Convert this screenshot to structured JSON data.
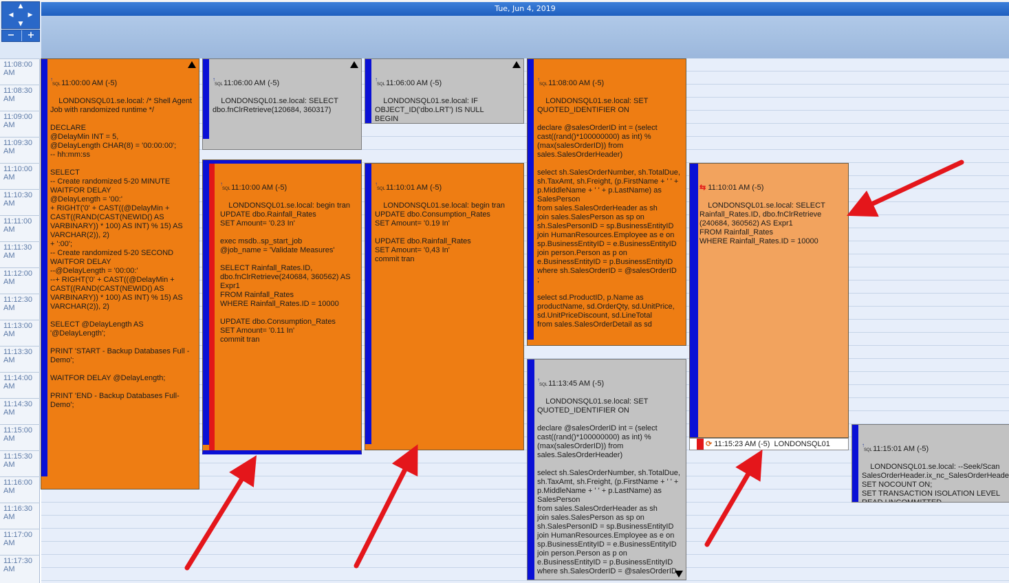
{
  "header": {
    "date": "Tue, Jun 4, 2019"
  },
  "nav": {
    "zoom_out": "−",
    "zoom_in": "+"
  },
  "times": [
    "11:08:00 AM",
    "11:08:30 AM",
    "11:09:00 AM",
    "11:09:30 AM",
    "11:10:00 AM",
    "11:10:30 AM",
    "11:11:00 AM",
    "11:11:30 AM",
    "11:12:00 AM",
    "11:12:30 AM",
    "11:13:00 AM",
    "11:13:30 AM",
    "11:14:00 AM",
    "11:14:30 AM",
    "11:15:00 AM",
    "11:15:30 AM",
    "11:16:00 AM",
    "11:16:30 AM",
    "11:17:00 AM",
    "11:17:30 AM"
  ],
  "icons": {
    "sql": "SQL",
    "bar_colors": {
      "blue": "#0a10d6",
      "red": "#e21818"
    }
  },
  "events": {
    "e1": {
      "time": "11:00:00 AM (-5)",
      "text": "LONDONSQL01.se.local: /* Shell Agent Job with randomized runtime */\n\nDECLARE\n@DelayMin INT = 5,\n@DelayLength CHAR(8) = '00:00:00';\n-- hh:mm:ss\n\nSELECT\n-- Create randomized 5-20 MINUTE WAITFOR DELAY\n@DelayLength = '00:'\n+ RIGHT('0' + CAST((@DelayMin + CAST((RAND(CAST(NEWID() AS VARBINARY)) * 100) AS INT) % 15) AS VARCHAR(2)), 2)\n+ ':00';\n-- Create randomized 5-20 SECOND WAITFOR DELAY\n--@DelayLength = '00:00:'\n--+ RIGHT('0' + CAST((@DelayMin + CAST((RAND(CAST(NEWID() AS VARBINARY)) * 100) AS INT) % 15) AS VARCHAR(2)), 2)\n\nSELECT @DelayLength AS '@DelayLength';\n\nPRINT 'START - Backup Databases Full -Demo';\n\nWAITFOR DELAY @DelayLength;\n\nPRINT 'END - Backup Databases Full-Demo';"
    },
    "e2": {
      "time": "11:06:00 AM (-5)",
      "text": "LONDONSQL01.se.local: SELECT dbo.fnClrRetrieve(120684, 360317)"
    },
    "e3": {
      "time": "11:06:00 AM (-5)",
      "text": "LONDONSQL01.se.local: IF OBJECT_ID('dbo.LRT') IS NULL\nBEGIN\nCREATE TABLE dbo.LRT\n(lrtid INT IDENTITY PRIMARY KEY CLUSTERED"
    },
    "e4": {
      "time": "11:08:00 AM (-5)",
      "text": "LONDONSQL01.se.local: SET QUOTED_IDENTIFIER ON\n\ndeclare @salesOrderID int = (select cast((rand()*100000000) as int) % (max(salesOrderID)) from sales.SalesOrderHeader)\n\nselect sh.SalesOrderNumber, sh.TotalDue, sh.TaxAmt, sh.Freight, (p.FirstName + ' ' + p.MiddleName + ' ' + p.LastName) as SalesPerson\nfrom sales.SalesOrderHeader as sh\njoin sales.SalesPerson as sp on sh.SalesPersonID = sp.BusinessEntityID\njoin HumanResources.Employee as e on sp.BusinessEntityID = e.BusinessEntityID\njoin person.Person as p on e.BusinessEntityID = p.BusinessEntityID\nwhere sh.SalesOrderID = @salesOrderID\n;\n\nselect sd.ProductID, p.Name as productName, sd.OrderQty, sd.UnitPrice, sd.UnitPriceDiscount, sd.LineTotal\nfrom sales.SalesOrderDetail as sd"
    },
    "e5": {
      "time": "11:10:00 AM (-5)",
      "text": "LONDONSQL01.se.local: begin tran\nUPDATE dbo.Rainfall_Rates\nSET Amount= '0.23 In'\n\nexec msdb..sp_start_job\n@job_name = 'Validate Measures'\n\nSELECT Rainfall_Rates.ID, dbo.fnClrRetrieve(240684, 360562) AS Expr1\nFROM Rainfall_Rates\nWHERE Rainfall_Rates.ID = 10000\n\nUPDATE dbo.Consumption_Rates\nSET Amount= '0.11 In'\ncommit tran"
    },
    "e6": {
      "time": "11:10:01 AM (-5)",
      "text": "LONDONSQL01.se.local: begin tran\nUPDATE dbo.Consumption_Rates\nSET Amount= '0.19 In'\n\nUPDATE dbo.Rainfall_Rates\nSET Amount= '0,43 In'\ncommit tran"
    },
    "e7": {
      "time": "11:10:01 AM (-5)",
      "text": "LONDONSQL01.se.local: SELECT Rainfall_Rates.ID, dbo.fnClrRetrieve (240684, 360562) AS Expr1\nFROM Rainfall_Rates\nWHERE Rainfall_Rates.ID = 10000"
    },
    "e8": {
      "time": "11:13:45 AM (-5)",
      "text": "LONDONSQL01.se.local: SET QUOTED_IDENTIFIER ON\n\ndeclare @salesOrderID int = (select cast((rand()*100000000) as int) % (max(salesOrderID)) from sales.SalesOrderHeader)\n\nselect sh.SalesOrderNumber, sh.TotalDue, sh.TaxAmt, sh.Freight, (p.FirstName + ' ' + p.MiddleName + ' ' + p.LastName) as SalesPerson\nfrom sales.SalesOrderHeader as sh\njoin sales.SalesPerson as sp on sh.SalesPersonID = sp.BusinessEntityID\njoin HumanResources.Employee as e on sp.BusinessEntityID = e.BusinessEntityID\njoin person.Person as p on e.BusinessEntityID = p.BusinessEntityID\nwhere sh.SalesOrderID = @salesOrderID"
    },
    "e9": {
      "time": "11:15:01 AM (-5)",
      "text": "LONDONSQL01.se.local: --Seek/Scan SalesOrderHeader.ix_nc_SalesOrderHeaderDueDate\nSET NOCOUNT ON;\nSET TRANSACTION ISOLATION LEVEL READ UNCOMMITTED\n\nDECLARE"
    },
    "e10": {
      "time": "11:15:23 AM (-5)",
      "text": "LONDONSQL01"
    }
  }
}
